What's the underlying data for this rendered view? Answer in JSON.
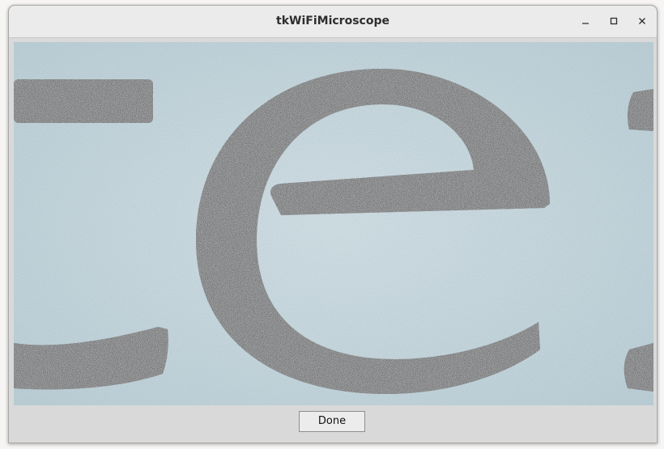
{
  "window": {
    "title": "tkWiFiMicroscope",
    "controls": {
      "minimize_icon": "minimize-icon",
      "maximize_icon": "maximize-icon",
      "close_icon": "close-icon"
    }
  },
  "main": {
    "done_label": "Done"
  },
  "colors": {
    "paper": "#c9dbe2",
    "ink": "#2f3338",
    "window_bg": "#d9d9d9",
    "titlebar_bg": "#ebebeb"
  }
}
